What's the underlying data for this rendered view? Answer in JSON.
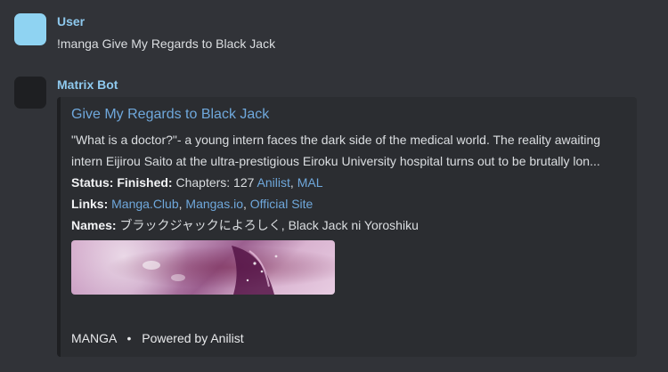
{
  "messages": [
    {
      "author": "User",
      "text": "!manga Give My Regards to Black Jack"
    },
    {
      "author": "Matrix Bot",
      "embed": {
        "title": "Give My Regards to Black Jack",
        "description": "\"What is a doctor?\"- a young intern faces the dark side of the medical world. The reality awaiting intern Eijirou Saito at the ultra-prestigious Eiroku University hospital turns out to be brutally lon...",
        "status": {
          "label": "Status:",
          "value_label": "Finished:",
          "value_text": "Chapters: 127",
          "links": [
            "Anilist",
            "MAL"
          ]
        },
        "links_field": {
          "label": "Links:",
          "links": [
            "Manga.Club",
            "Mangas.io",
            "Official Site"
          ]
        },
        "names": {
          "label": "Names:",
          "value": "ブラックジャックによろしく, Black Jack ni Yoroshiku"
        },
        "footer": {
          "type": "MANGA",
          "separator": "•",
          "powered": "Powered by Anilist"
        }
      }
    }
  ]
}
